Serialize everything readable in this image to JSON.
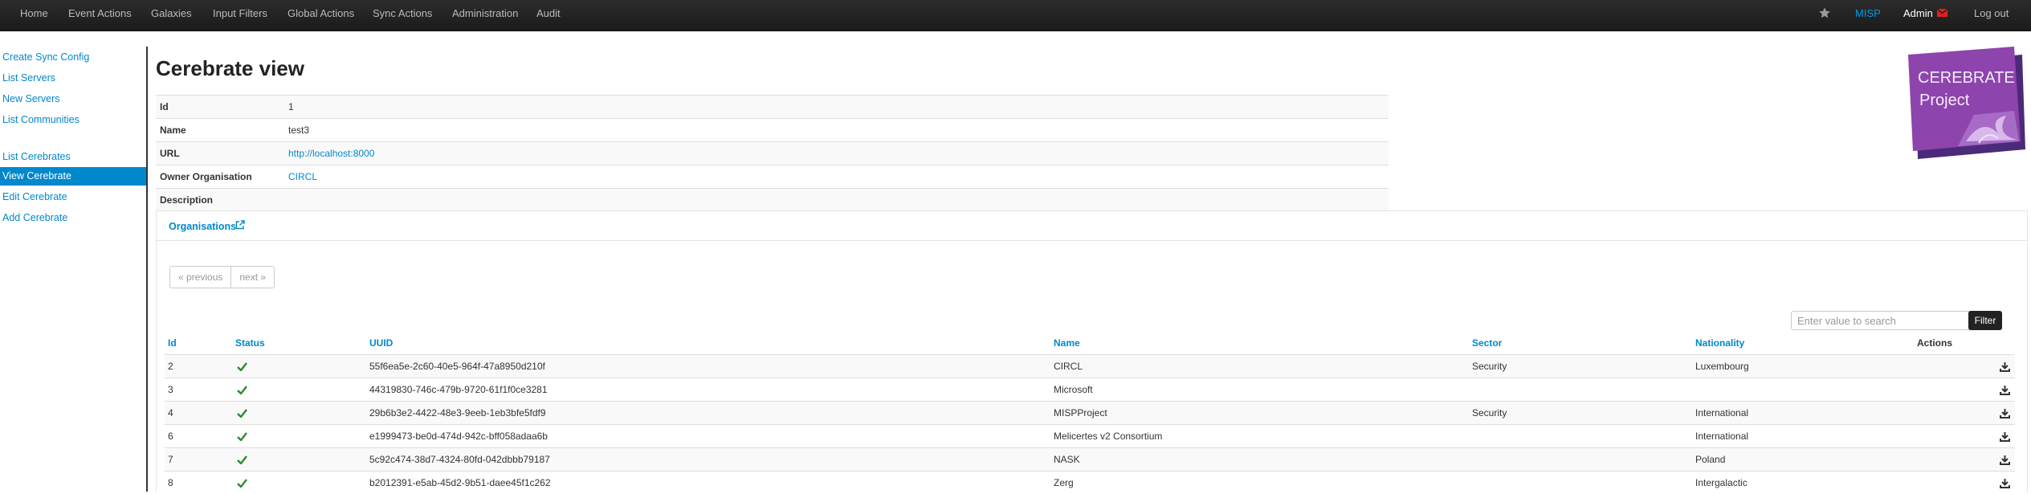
{
  "topnav": {
    "items": [
      "Home",
      "Event Actions",
      "Galaxies",
      "Input Filters",
      "Global Actions",
      "Sync Actions",
      "Administration",
      "Audit"
    ],
    "misp": "MISP",
    "user": "Admin",
    "logout": "Log out"
  },
  "sidebar": {
    "items": [
      "Create Sync Config",
      "List Servers",
      "New Servers",
      "List Communities",
      "List Cerebrates",
      "View Cerebrate",
      "Edit Cerebrate",
      "Add Cerebrate"
    ],
    "active": "View Cerebrate"
  },
  "page": {
    "title": "Cerebrate view"
  },
  "logo": {
    "line1": "CEREBRATE",
    "line2": "Project"
  },
  "details": [
    {
      "key": "Id",
      "value": "1"
    },
    {
      "key": "Name",
      "value": "test3"
    },
    {
      "key": "URL",
      "value": "http://localhost:8000"
    },
    {
      "key": "Owner Organisation",
      "value": "CIRCL"
    },
    {
      "key": "Description",
      "value": ""
    }
  ],
  "orgs_panel": {
    "title": "Organisations",
    "pager": {
      "previous": "« previous",
      "next": "next »"
    },
    "search_placeholder": "Enter value to search",
    "filter_label": "Filter",
    "columns": [
      "Id",
      "Status",
      "UUID",
      "Name",
      "Sector",
      "Nationality",
      "Actions"
    ],
    "rows": [
      {
        "id": "2",
        "uuid": "55f6ea5e-2c60-40e5-964f-47a8950d210f",
        "name": "CIRCL",
        "sector": "Security",
        "nationality": "Luxembourg"
      },
      {
        "id": "3",
        "uuid": "44319830-746c-479b-9720-61f1f0ce3281",
        "name": "Microsoft",
        "sector": "",
        "nationality": ""
      },
      {
        "id": "4",
        "uuid": "29b6b3e2-4422-48e3-9eeb-1eb3bfe5fdf9",
        "name": "MISPProject",
        "sector": "Security",
        "nationality": "International"
      },
      {
        "id": "6",
        "uuid": "e1999473-be0d-474d-942c-bff058adaa6b",
        "name": "Melicertes v2 Consortium",
        "sector": "",
        "nationality": "International"
      },
      {
        "id": "7",
        "uuid": "5c92c474-38d7-4324-80fd-042dbbb79187",
        "name": "NASK",
        "sector": "",
        "nationality": "Poland"
      },
      {
        "id": "8",
        "uuid": "b2012391-e5ab-45d2-9b51-daee45f1c262",
        "name": "Zerg",
        "sector": "",
        "nationality": "Intergalactic"
      }
    ]
  },
  "colors": {
    "link": "#0088cc",
    "navbar": "#1b1b1b",
    "check": "#2e8b2e",
    "envelope": "#e02020"
  },
  "icons": {
    "favourite": "star-icon",
    "messages": "envelope-icon",
    "external": "external-link-icon",
    "status": "check-icon",
    "action": "download-icon"
  }
}
